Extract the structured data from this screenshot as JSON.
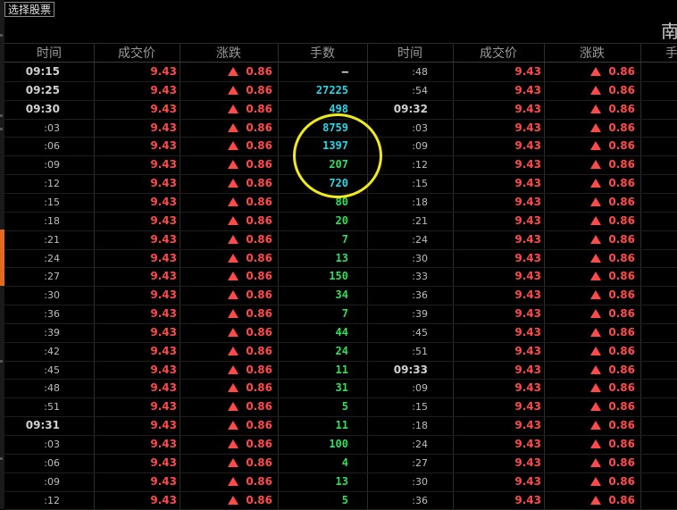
{
  "toolbar": {
    "select_stock_label": "选择股票"
  },
  "stock_name_fragment": "南",
  "headers": {
    "left": [
      "时间",
      "成交价",
      "涨跌",
      "手数"
    ],
    "right": [
      "时间",
      "成交价",
      "涨跌",
      "手"
    ]
  },
  "colors": {
    "price": "#ff4a4a",
    "volume_buy": "#27d7e8",
    "volume_sell": "#2ee05a",
    "highlight_circle": "#f0ea19",
    "accent": "#e36a1e"
  },
  "left_rows": [
    {
      "time": "09:15",
      "time_style": "full",
      "price": "9.43",
      "change": "0.86",
      "volume": "—",
      "vol_color": "dash"
    },
    {
      "time": "09:25",
      "time_style": "full",
      "price": "9.43",
      "change": "0.86",
      "volume": "27225",
      "vol_color": "cyan"
    },
    {
      "time": "09:30",
      "time_style": "full",
      "price": "9.43",
      "change": "0.86",
      "volume": "498",
      "vol_color": "cyan"
    },
    {
      "time": ":03",
      "time_style": "sub",
      "price": "9.43",
      "change": "0.86",
      "volume": "8759",
      "vol_color": "cyan"
    },
    {
      "time": ":06",
      "time_style": "sub",
      "price": "9.43",
      "change": "0.86",
      "volume": "1397",
      "vol_color": "cyan"
    },
    {
      "time": ":09",
      "time_style": "sub",
      "price": "9.43",
      "change": "0.86",
      "volume": "207",
      "vol_color": "green"
    },
    {
      "time": ":12",
      "time_style": "sub",
      "price": "9.43",
      "change": "0.86",
      "volume": "720",
      "vol_color": "cyan"
    },
    {
      "time": ":15",
      "time_style": "sub",
      "price": "9.43",
      "change": "0.86",
      "volume": "80",
      "vol_color": "green"
    },
    {
      "time": ":18",
      "time_style": "sub",
      "price": "9.43",
      "change": "0.86",
      "volume": "20",
      "vol_color": "green"
    },
    {
      "time": ":21",
      "time_style": "sub",
      "price": "9.43",
      "change": "0.86",
      "volume": "7",
      "vol_color": "green"
    },
    {
      "time": ":24",
      "time_style": "sub",
      "price": "9.43",
      "change": "0.86",
      "volume": "13",
      "vol_color": "green"
    },
    {
      "time": ":27",
      "time_style": "sub",
      "price": "9.43",
      "change": "0.86",
      "volume": "150",
      "vol_color": "green"
    },
    {
      "time": ":30",
      "time_style": "sub",
      "price": "9.43",
      "change": "0.86",
      "volume": "34",
      "vol_color": "green"
    },
    {
      "time": ":36",
      "time_style": "sub",
      "price": "9.43",
      "change": "0.86",
      "volume": "7",
      "vol_color": "green"
    },
    {
      "time": ":39",
      "time_style": "sub",
      "price": "9.43",
      "change": "0.86",
      "volume": "44",
      "vol_color": "green"
    },
    {
      "time": ":42",
      "time_style": "sub",
      "price": "9.43",
      "change": "0.86",
      "volume": "24",
      "vol_color": "green"
    },
    {
      "time": ":45",
      "time_style": "sub",
      "price": "9.43",
      "change": "0.86",
      "volume": "11",
      "vol_color": "green"
    },
    {
      "time": ":48",
      "time_style": "sub",
      "price": "9.43",
      "change": "0.86",
      "volume": "31",
      "vol_color": "green"
    },
    {
      "time": ":51",
      "time_style": "sub",
      "price": "9.43",
      "change": "0.86",
      "volume": "5",
      "vol_color": "green"
    },
    {
      "time": "09:31",
      "time_style": "full",
      "price": "9.43",
      "change": "0.86",
      "volume": "11",
      "vol_color": "green"
    },
    {
      "time": ":03",
      "time_style": "sub",
      "price": "9.43",
      "change": "0.86",
      "volume": "100",
      "vol_color": "green"
    },
    {
      "time": ":06",
      "time_style": "sub",
      "price": "9.43",
      "change": "0.86",
      "volume": "4",
      "vol_color": "green"
    },
    {
      "time": ":09",
      "time_style": "sub",
      "price": "9.43",
      "change": "0.86",
      "volume": "13",
      "vol_color": "green"
    },
    {
      "time": ":12",
      "time_style": "sub",
      "price": "9.43",
      "change": "0.86",
      "volume": "5",
      "vol_color": "green"
    }
  ],
  "right_rows": [
    {
      "time": ":48",
      "time_style": "sub",
      "price": "9.43",
      "change": "0.86"
    },
    {
      "time": ":54",
      "time_style": "sub",
      "price": "9.43",
      "change": "0.86"
    },
    {
      "time": "09:32",
      "time_style": "full",
      "price": "9.43",
      "change": "0.86"
    },
    {
      "time": ":03",
      "time_style": "sub",
      "price": "9.43",
      "change": "0.86"
    },
    {
      "time": ":09",
      "time_style": "sub",
      "price": "9.43",
      "change": "0.86"
    },
    {
      "time": ":12",
      "time_style": "sub",
      "price": "9.43",
      "change": "0.86"
    },
    {
      "time": ":15",
      "time_style": "sub",
      "price": "9.43",
      "change": "0.86"
    },
    {
      "time": ":18",
      "time_style": "sub",
      "price": "9.43",
      "change": "0.86"
    },
    {
      "time": ":21",
      "time_style": "sub",
      "price": "9.43",
      "change": "0.86"
    },
    {
      "time": ":24",
      "time_style": "sub",
      "price": "9.43",
      "change": "0.86"
    },
    {
      "time": ":30",
      "time_style": "sub",
      "price": "9.43",
      "change": "0.86"
    },
    {
      "time": ":33",
      "time_style": "sub",
      "price": "9.43",
      "change": "0.86"
    },
    {
      "time": ":36",
      "time_style": "sub",
      "price": "9.43",
      "change": "0.86"
    },
    {
      "time": ":39",
      "time_style": "sub",
      "price": "9.43",
      "change": "0.86"
    },
    {
      "time": ":45",
      "time_style": "sub",
      "price": "9.43",
      "change": "0.86"
    },
    {
      "time": ":51",
      "time_style": "sub",
      "price": "9.43",
      "change": "0.86"
    },
    {
      "time": "09:33",
      "time_style": "full",
      "price": "9.43",
      "change": "0.86"
    },
    {
      "time": ":09",
      "time_style": "sub",
      "price": "9.43",
      "change": "0.86"
    },
    {
      "time": ":15",
      "time_style": "sub",
      "price": "9.43",
      "change": "0.86"
    },
    {
      "time": ":18",
      "time_style": "sub",
      "price": "9.43",
      "change": "0.86"
    },
    {
      "time": ":24",
      "time_style": "sub",
      "price": "9.43",
      "change": "0.86"
    },
    {
      "time": ":27",
      "time_style": "sub",
      "price": "9.43",
      "change": "0.86"
    },
    {
      "time": ":30",
      "time_style": "sub",
      "price": "9.43",
      "change": "0.86"
    },
    {
      "time": ":36",
      "time_style": "sub",
      "price": "9.43",
      "change": "0.86"
    }
  ]
}
